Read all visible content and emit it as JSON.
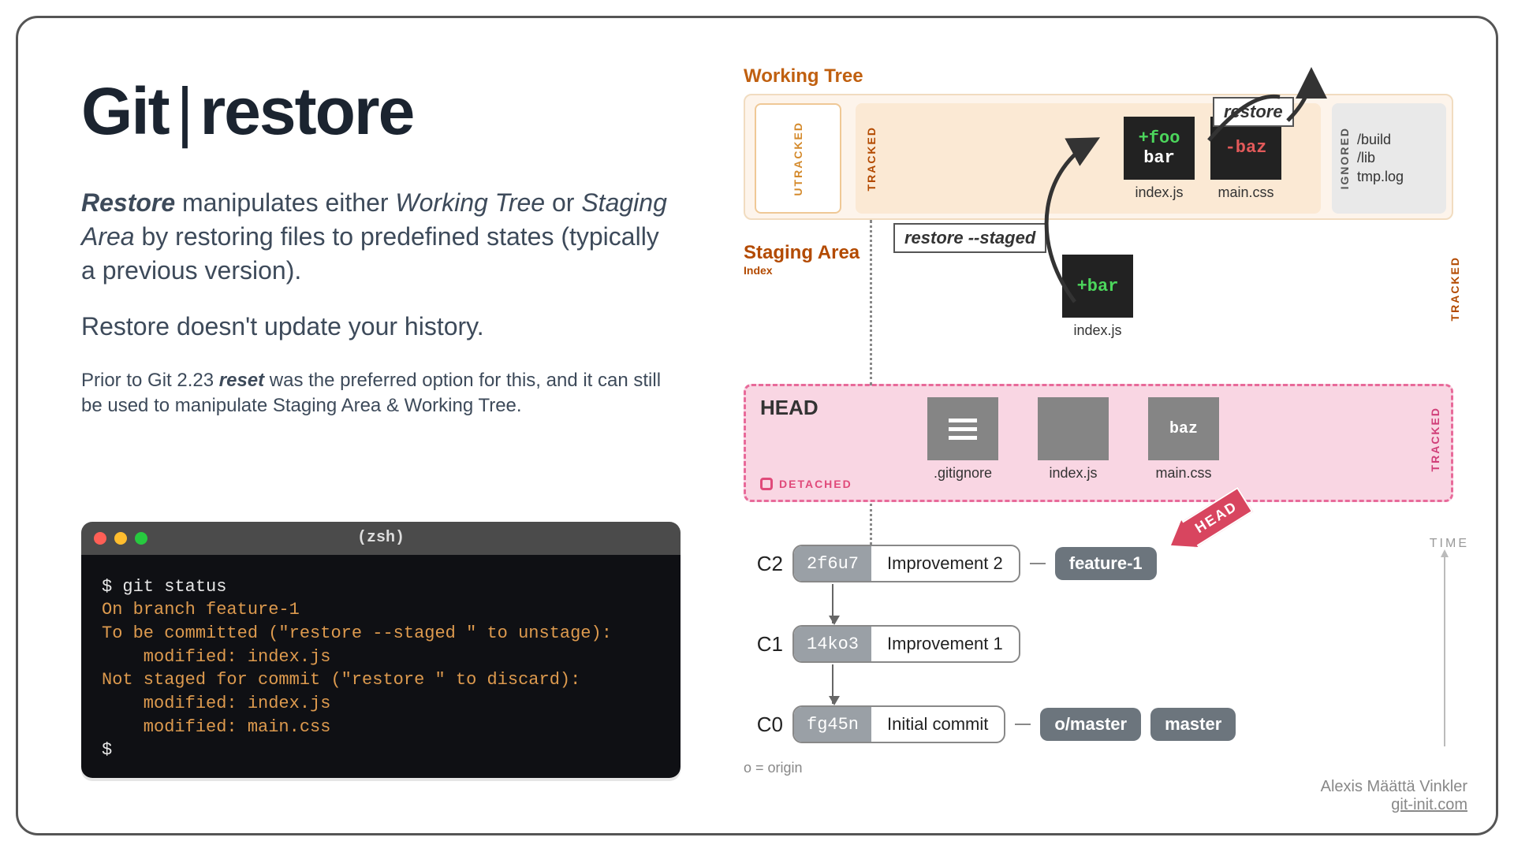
{
  "title": {
    "left": "Git",
    "right": "restore"
  },
  "para1_lead": "Restore",
  "para1_rest": " manipulates either ",
  "para1_i1": "Working Tree",
  "para1_mid": " or ",
  "para1_i2": "Staging Area",
  "para1_end": " by restoring files to predefined states (typically a previous version).",
  "para2": "Restore doesn't update your history.",
  "small_pre": "Prior to Git 2.23 ",
  "small_b": "reset",
  "small_post": " was the preferred option for this, and it can still be used to manipulate Staging Area & Working Tree.",
  "terminal": {
    "shell": "(zsh)",
    "lines": [
      {
        "cls": "white",
        "t": "$ git status"
      },
      {
        "cls": "orange",
        "t": "On branch feature-1"
      },
      {
        "cls": "orange",
        "t": "To be committed (\"restore --staged <f>\" to unstage):"
      },
      {
        "cls": "orange",
        "t": "    modified: index.js"
      },
      {
        "cls": "orange",
        "t": "Not staged for commit (\"restore <f>\" to discard):"
      },
      {
        "cls": "orange",
        "t": "    modified: index.js"
      },
      {
        "cls": "orange",
        "t": "    modified: main.css"
      },
      {
        "cls": "white",
        "t": "$"
      }
    ]
  },
  "wt": {
    "title": "Working Tree",
    "utracked": "UTRACKED",
    "tracked": "TRACKED",
    "ignored": "IGNORED",
    "ignored_items": [
      "/build",
      "/lib",
      "tmp.log"
    ],
    "file1": {
      "l1": "+foo",
      "l2": "bar",
      "cap": "index.js"
    },
    "file2": {
      "l1": "-baz",
      "cap": "main.css"
    }
  },
  "callout_restore": "restore",
  "callout_restore_staged": "restore --staged",
  "staging": {
    "title": "Staging Area",
    "sub": "Index",
    "tracked": "TRACKED",
    "file": {
      "l1": "+bar",
      "cap": "index.js"
    }
  },
  "head": {
    "title": "HEAD",
    "detached": "DETACHED",
    "tracked": "TRACKED",
    "files": [
      ".gitignore",
      "index.js",
      "main.css"
    ],
    "baz": "baz",
    "arrow": "HEAD"
  },
  "commits": [
    {
      "label": "C2",
      "hash": "2f6u7",
      "msg": "Improvement 2",
      "branches": [
        "feature-1"
      ]
    },
    {
      "label": "C1",
      "hash": "14ko3",
      "msg": "Improvement 1",
      "branches": []
    },
    {
      "label": "C0",
      "hash": "fg45n",
      "msg": "Initial commit",
      "branches": [
        "o/master",
        "master"
      ]
    }
  ],
  "origin_note": "o = origin",
  "time": "TIME",
  "credit": {
    "name": "Alexis Määttä Vinkler",
    "site": "git-init.com"
  }
}
